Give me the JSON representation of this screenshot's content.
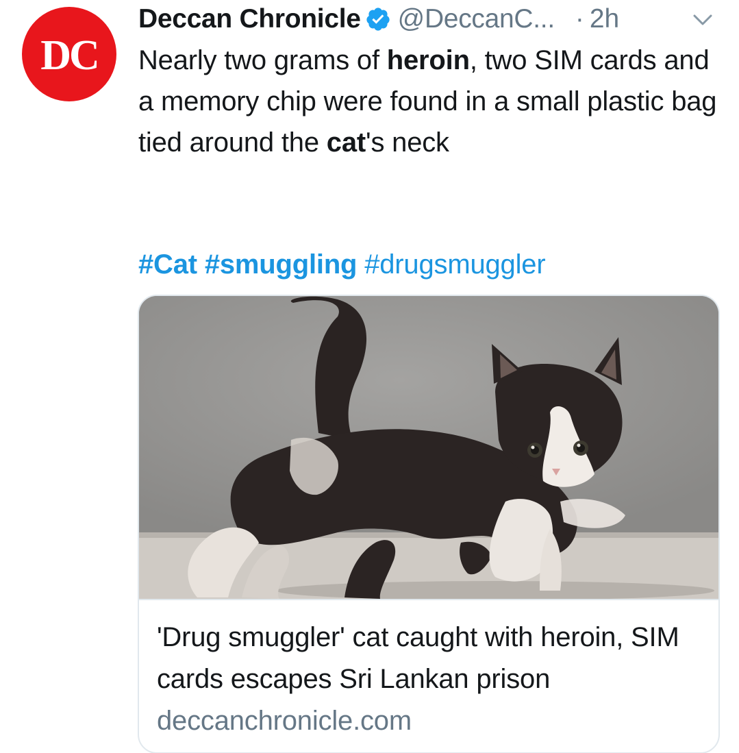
{
  "avatar": {
    "text": "DC",
    "color": "#e8161c"
  },
  "header": {
    "display_name": "Deccan Chronicle",
    "handle": "@DeccanC...",
    "separator": "·",
    "time": "2h",
    "verified_icon": "verified-badge-icon",
    "menu_icon": "chevron-down-icon"
  },
  "tweet": {
    "text_segments": [
      {
        "text": "Nearly two grams of ",
        "bold": false
      },
      {
        "text": "heroin",
        "bold": true
      },
      {
        "text": ", two SIM cards and a memory chip were found in a small plastic bag tied around the ",
        "bold": false
      },
      {
        "text": "cat",
        "bold": true
      },
      {
        "text": "'s neck",
        "bold": false
      }
    ],
    "hashtags": [
      {
        "text": "#Cat",
        "bold": true
      },
      {
        "text": "#smuggling",
        "bold": true
      },
      {
        "text": "#drugsmuggler",
        "bold": false
      }
    ]
  },
  "card": {
    "image_subject": "black and white kitten walking",
    "title": "'Drug smuggler' cat caught with heroin, SIM cards escapes Sri Lankan prison",
    "domain": "deccanchronicle.com"
  },
  "colors": {
    "link": "#1b95e0",
    "secondary_text": "#657786",
    "verified": "#1da1f2",
    "border": "#e1e8ed"
  }
}
